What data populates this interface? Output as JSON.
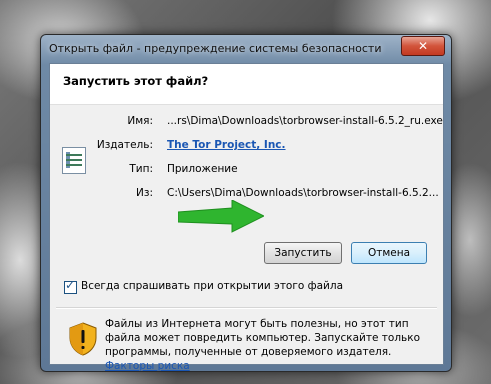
{
  "dialog": {
    "title": "Открыть файл - предупреждение системы безопасности",
    "header": "Запустить этот файл?",
    "fields": {
      "name_label": "Имя:",
      "name_value": "...rs\\Dima\\Downloads\\torbrowser-install-6.5.2_ru.exe",
      "publisher_label": "Издатель:",
      "publisher_value": "The Tor Project, Inc.",
      "type_label": "Тип:",
      "type_value": "Приложение",
      "from_label": "Из:",
      "from_value": "C:\\Users\\Dima\\Downloads\\torbrowser-install-6.5.2..."
    },
    "buttons": {
      "run": "Запустить",
      "cancel": "Отмена"
    },
    "checkbox": {
      "label": "Всегда спрашивать при открытии этого файла",
      "checked": true
    },
    "warning": {
      "text": "Файлы из Интернета могут быть полезны, но этот тип файла может повредить компьютер. Запускайте только программы, полученные от доверяемого издателя.",
      "link": "Факторы риска"
    }
  },
  "icons": {
    "close": "close-icon",
    "file": "file-icon",
    "shield": "shield-warning-icon",
    "arrow": "arrow-icon"
  },
  "colors": {
    "link": "#1a56b3",
    "arrow": "#2fb52f"
  }
}
